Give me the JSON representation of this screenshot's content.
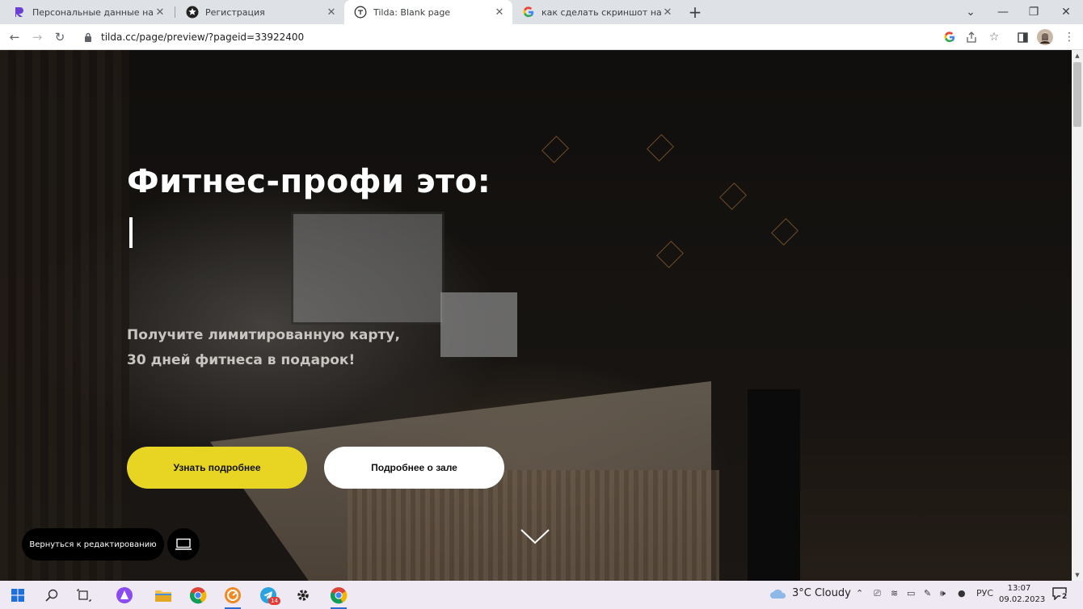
{
  "browser": {
    "tabs": [
      {
        "title": "Персональные данные на Freel",
        "favicon": "freelancer-r-icon",
        "active": false
      },
      {
        "title": "Регистрация",
        "favicon": "star-badge-icon",
        "active": false
      },
      {
        "title": "Tilda: Blank page",
        "favicon": "tilda-t-icon",
        "active": true
      },
      {
        "title": "как сделать скриншот на ноутб",
        "favicon": "google-g-icon",
        "active": false
      }
    ],
    "url": "tilda.cc/page/preview/?pageid=33922400"
  },
  "hero": {
    "title": "Фитнес-профи это:",
    "subtitle_line1": "Получите лимитированную карту,",
    "subtitle_line2": "30 дней фитнеса в подарок!",
    "btn_primary": "Узнать подробнее",
    "btn_secondary": "Подробнее о зале",
    "accent_color": "#e8d523"
  },
  "editor": {
    "back_label": "Вернуться к редактированию"
  },
  "taskbar": {
    "telegram_badge": "14",
    "weather": "3°C Cloudy",
    "lang": "РУС",
    "time": "13:07",
    "date": "09.02.2023",
    "notifications": "2"
  }
}
